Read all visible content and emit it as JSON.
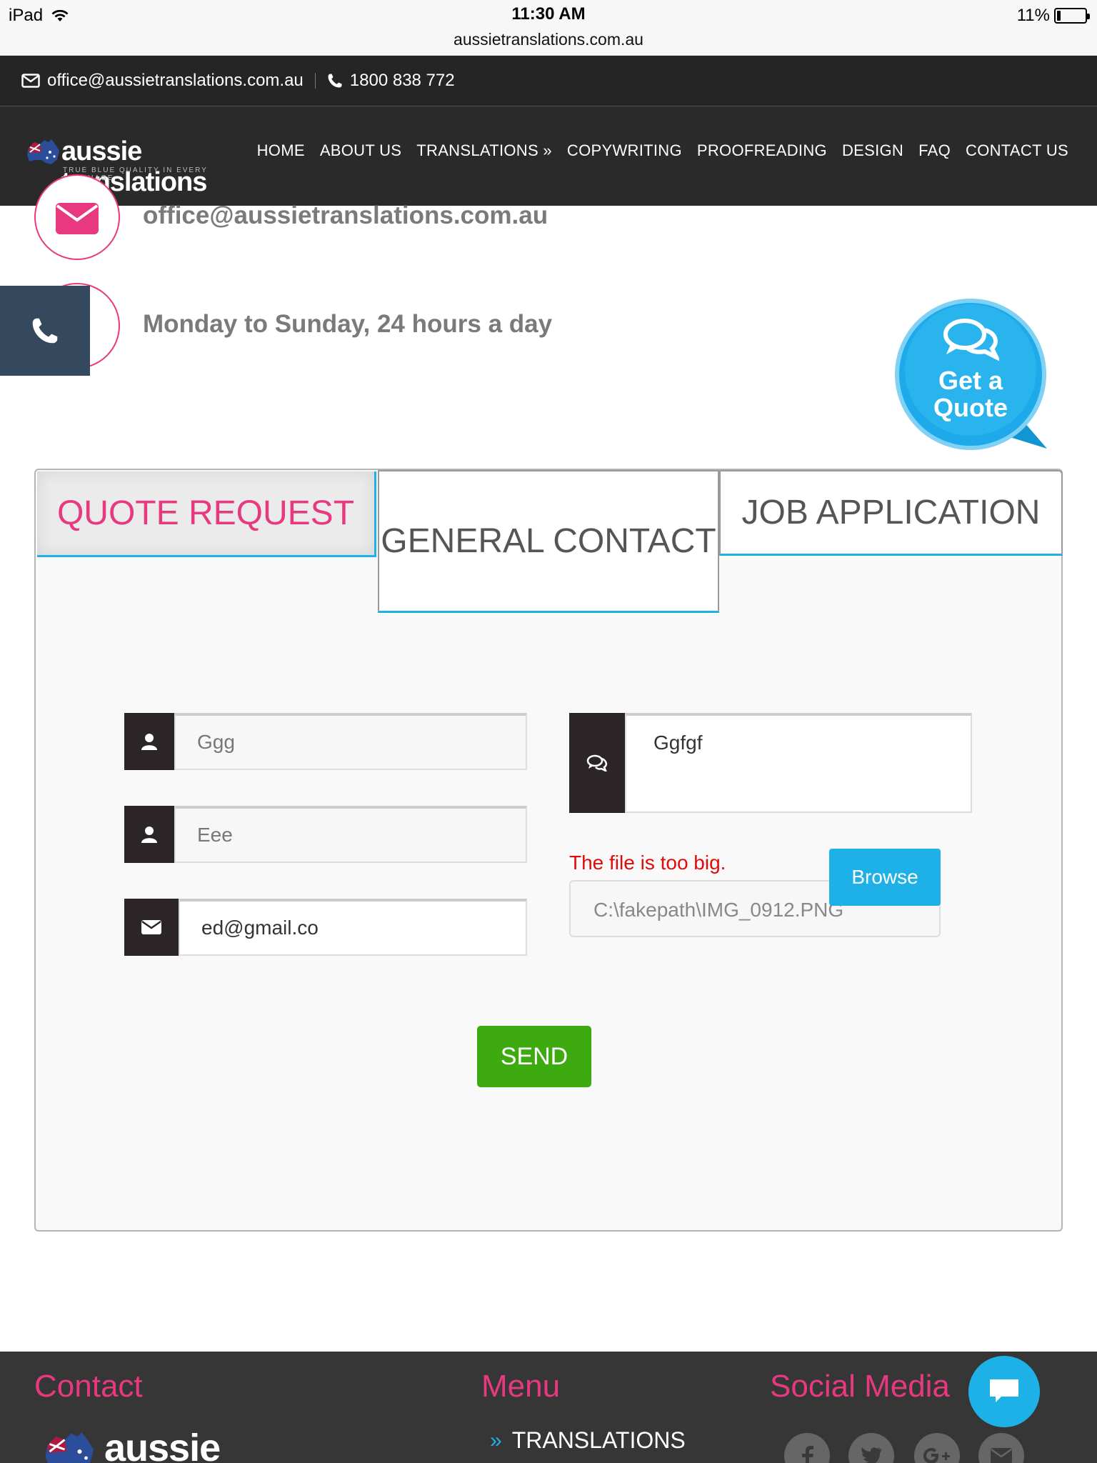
{
  "status_bar": {
    "device": "iPad",
    "time": "11:30 AM",
    "url": "aussietranslations.com.au",
    "battery_percent": "11%",
    "battery_level": 0.11
  },
  "topbar": {
    "email": "office@aussietranslations.com.au",
    "phone": "1800 838 772"
  },
  "brand": {
    "name": "aussie translations",
    "tagline": "TRUE BLUE QUALITY IN EVERY LANGUAGE"
  },
  "nav": {
    "items": [
      {
        "label": "HOME"
      },
      {
        "label": "ABOUT US"
      },
      {
        "label": "TRANSLATIONS »"
      },
      {
        "label": "COPYWRITING"
      },
      {
        "label": "PROOFREADING"
      },
      {
        "label": "DESIGN"
      },
      {
        "label": "FAQ"
      },
      {
        "label": "CONTACT US"
      }
    ]
  },
  "contact_info": {
    "email": "office@aussietranslations.com.au",
    "hours": "Monday to Sunday, 24 hours a day"
  },
  "get_quote": {
    "line1": "Get a",
    "line2": "Quote"
  },
  "form": {
    "tabs": {
      "quote_request": "QUOTE REQUEST",
      "general_contact": "GENERAL CONTACT",
      "job_application": "JOB APPLICATION"
    },
    "name_value": "Ggg",
    "surname_value": "Eee",
    "email_value": "ed@gmail.co",
    "message_value": "Ggfgf",
    "error": "The file is too big.",
    "file_path": "C:\\fakepath\\IMG_0912.PNG",
    "browse_label": "Browse",
    "send_label": "SEND"
  },
  "footer": {
    "contact_heading": "Contact",
    "menu_heading": "Menu",
    "social_heading": "Social Media",
    "logo_text": "aussie translations",
    "menu_items": [
      {
        "label": "TRANSLATIONS"
      }
    ]
  },
  "colors": {
    "accent_pink": "#e8387f",
    "accent_blue": "#1eb1e8",
    "send_green": "#3dab0f",
    "error_red": "#e00b0b",
    "dark_bar": "#252525"
  }
}
